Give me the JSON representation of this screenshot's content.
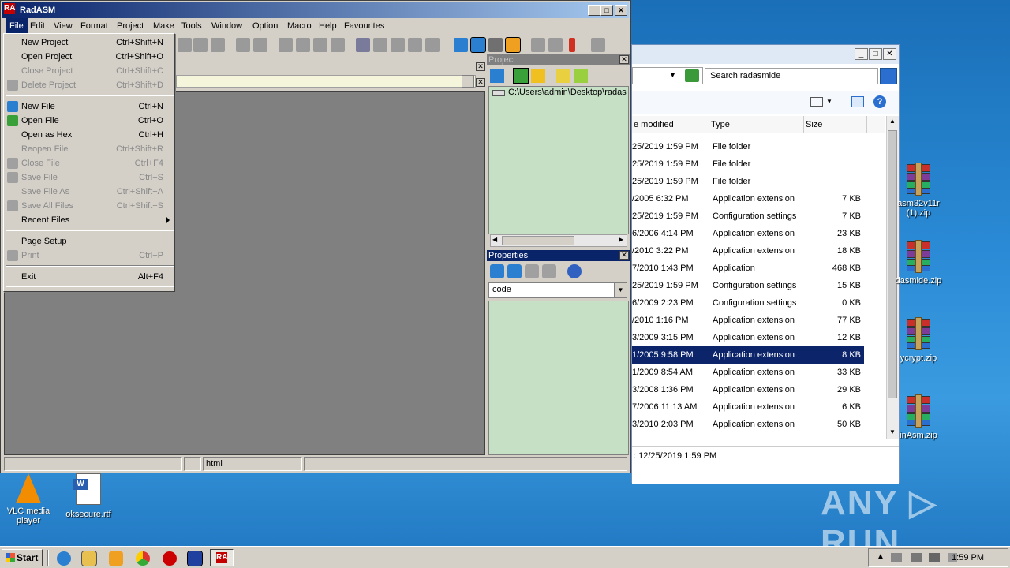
{
  "app": {
    "title": "RadASM",
    "logo_text": "RA"
  },
  "menubar": [
    "File",
    "Edit",
    "View",
    "Format",
    "Project",
    "Make",
    "Tools",
    "Window",
    "Option",
    "Macro",
    "Help",
    "Favourites"
  ],
  "file_menu": [
    {
      "label": "New Project",
      "shortcut": "Ctrl+Shift+N",
      "enabled": true
    },
    {
      "label": "Open Project",
      "shortcut": "Ctrl+Shift+O",
      "enabled": true
    },
    {
      "label": "Close Project",
      "shortcut": "Ctrl+Shift+C",
      "enabled": false
    },
    {
      "label": "Delete Project",
      "shortcut": "Ctrl+Shift+D",
      "enabled": false
    },
    {
      "label": "New File",
      "shortcut": "Ctrl+N",
      "enabled": true
    },
    {
      "label": "Open File",
      "shortcut": "Ctrl+O",
      "enabled": true
    },
    {
      "label": "Open as Hex",
      "shortcut": "Ctrl+H",
      "enabled": true
    },
    {
      "label": "Reopen File",
      "shortcut": "Ctrl+Shift+R",
      "enabled": false
    },
    {
      "label": "Close File",
      "shortcut": "Ctrl+F4",
      "enabled": false
    },
    {
      "label": "Save File",
      "shortcut": "Ctrl+S",
      "enabled": false
    },
    {
      "label": "Save File As",
      "shortcut": "Ctrl+Shift+A",
      "enabled": false
    },
    {
      "label": "Save All Files",
      "shortcut": "Ctrl+Shift+S",
      "enabled": false
    },
    {
      "label": "Recent Files",
      "shortcut": "",
      "enabled": true
    },
    {
      "label": "Page Setup",
      "shortcut": "",
      "enabled": true
    },
    {
      "label": "Print",
      "shortcut": "Ctrl+P",
      "enabled": false
    },
    {
      "label": "Exit",
      "shortcut": "Alt+F4",
      "enabled": true
    }
  ],
  "project_pane": {
    "title": "Project",
    "tree_item": "C:\\Users\\admin\\Desktop\\radas"
  },
  "properties_pane": {
    "title": "Properties",
    "combo_value": "code"
  },
  "statusbar": {
    "cell3": "html"
  },
  "explorer": {
    "search_placeholder": "Search radasmide",
    "columns": [
      "e modified",
      "Type",
      "Size"
    ],
    "rows": [
      {
        "date": "25/2019 1:59 PM",
        "type": "File folder",
        "size": ""
      },
      {
        "date": "25/2019 1:59 PM",
        "type": "File folder",
        "size": ""
      },
      {
        "date": "25/2019 1:59 PM",
        "type": "File folder",
        "size": ""
      },
      {
        "date": "/2005 6:32 PM",
        "type": "Application extension",
        "size": "7 KB"
      },
      {
        "date": "25/2019 1:59 PM",
        "type": "Configuration settings",
        "size": "7 KB"
      },
      {
        "date": "6/2006 4:14 PM",
        "type": "Application extension",
        "size": "23 KB"
      },
      {
        "date": "/2010 3:22 PM",
        "type": "Application extension",
        "size": "18 KB"
      },
      {
        "date": "7/2010 1:43 PM",
        "type": "Application",
        "size": "468 KB"
      },
      {
        "date": "25/2019 1:59 PM",
        "type": "Configuration settings",
        "size": "15 KB"
      },
      {
        "date": "6/2009 2:23 PM",
        "type": "Configuration settings",
        "size": "0 KB"
      },
      {
        "date": "/2010 1:16 PM",
        "type": "Application extension",
        "size": "77 KB"
      },
      {
        "date": "3/2009 3:15 PM",
        "type": "Application extension",
        "size": "12 KB"
      },
      {
        "date": "1/2005 9:58 PM",
        "type": "Application extension",
        "size": "8 KB",
        "selected": true
      },
      {
        "date": "1/2009 8:54 AM",
        "type": "Application extension",
        "size": "33 KB"
      },
      {
        "date": "3/2008 1:36 PM",
        "type": "Application extension",
        "size": "29 KB"
      },
      {
        "date": "7/2006 11:13 AM",
        "type": "Application extension",
        "size": "6 KB"
      },
      {
        "date": "3/2010 2:03 PM",
        "type": "Application extension",
        "size": "50 KB"
      }
    ],
    "status_text": ": 12/25/2019 1:59 PM"
  },
  "desktop_icons": [
    {
      "label": "asm32v11r (1).zip",
      "icon": "winrar-archive-icon"
    },
    {
      "label": "dasmide.zip",
      "icon": "winrar-archive-icon"
    },
    {
      "label": "ycrypt.zip",
      "icon": "winrar-archive-icon"
    },
    {
      "label": "inAsm.zip",
      "icon": "winrar-archive-icon"
    },
    {
      "label": "VLC media player",
      "icon": "vlc-icon"
    },
    {
      "label": "oksecure.rtf",
      "icon": "word-document-icon"
    }
  ],
  "taskbar": {
    "start_label": "Start",
    "clock": "1:59 PM"
  },
  "watermark": "ANY ▷ RUN",
  "colors": {
    "title_active": "#0a246a",
    "pane_green": "#c6e0c6",
    "editor_gray": "#808080",
    "selection": "#0b246a"
  }
}
